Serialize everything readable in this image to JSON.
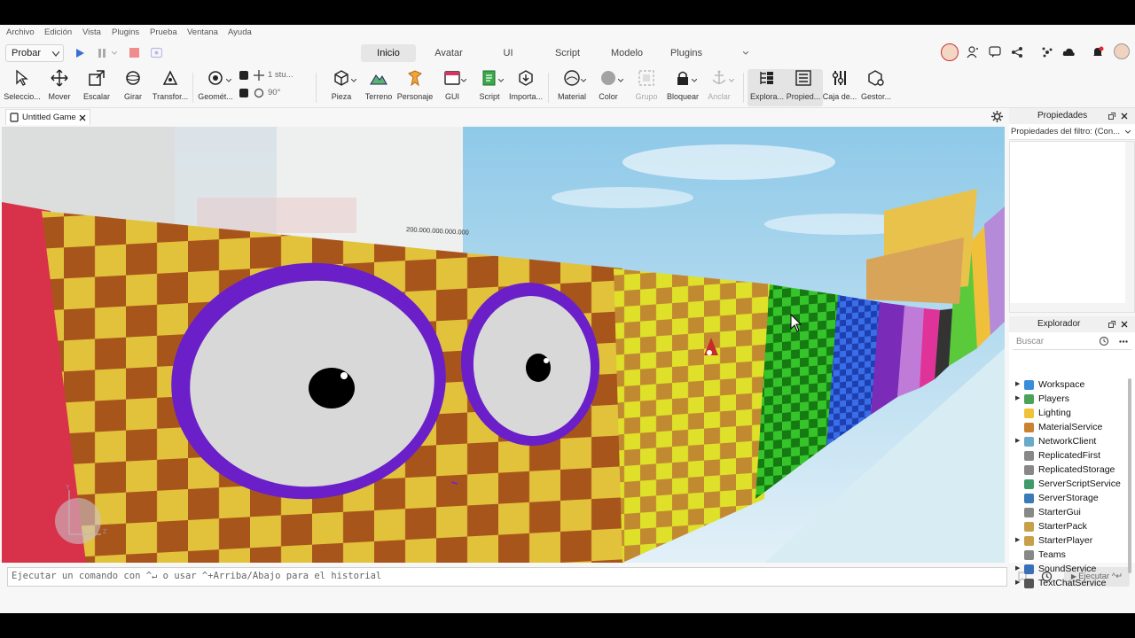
{
  "menu": [
    "Archivo",
    "Edición",
    "Vista",
    "Plugins",
    "Prueba",
    "Ventana",
    "Ayuda"
  ],
  "test_dropdown": "Probar",
  "ribbon_tabs": [
    "Inicio",
    "Avatar",
    "UI",
    "Script",
    "Modelo",
    "Plugins"
  ],
  "tools": {
    "select": "Seleccio...",
    "move": "Mover",
    "scale": "Escalar",
    "rotate": "Girar",
    "transform": "Transfor...",
    "geometry": "Geomét...",
    "move_step": "1 stu...",
    "rotate_step": "90°",
    "part": "Pieza",
    "terrain": "Terreno",
    "character": "Personaje",
    "gui": "GUI",
    "script": "Script",
    "import": "Importa...",
    "material": "Material",
    "color": "Color",
    "group": "Grupo",
    "lock": "Bloquear",
    "anchor": "Anclar",
    "explorer": "Explora...",
    "properties": "Propied...",
    "toolbox": "Caja de...",
    "manager": "Gestor..."
  },
  "doc_tab": "Untitled Game",
  "viewport": {
    "billboard_text": "200.000.000.000.000",
    "axis_y": "Y",
    "axis_z": "Z"
  },
  "properties_panel": {
    "title": "Propiedades",
    "filter": "Propiedades del filtro: (Con..."
  },
  "explorer_panel": {
    "title": "Explorador",
    "search_placeholder": "Buscar",
    "items": [
      {
        "name": "Workspace",
        "expandable": true,
        "color": "#3a8dd8"
      },
      {
        "name": "Players",
        "expandable": true,
        "color": "#4ba35a"
      },
      {
        "name": "Lighting",
        "expandable": false,
        "color": "#f0c23a"
      },
      {
        "name": "MaterialService",
        "expandable": false,
        "color": "#c9822f"
      },
      {
        "name": "NetworkClient",
        "expandable": true,
        "color": "#6aa9c8"
      },
      {
        "name": "ReplicatedFirst",
        "expandable": false,
        "color": "#888888"
      },
      {
        "name": "ReplicatedStorage",
        "expandable": false,
        "color": "#888888"
      },
      {
        "name": "ServerScriptService",
        "expandable": false,
        "color": "#3f9b6a"
      },
      {
        "name": "ServerStorage",
        "expandable": false,
        "color": "#3a7ab8"
      },
      {
        "name": "StarterGui",
        "expandable": false,
        "color": "#888888"
      },
      {
        "name": "StarterPack",
        "expandable": false,
        "color": "#c9a04a"
      },
      {
        "name": "StarterPlayer",
        "expandable": true,
        "color": "#c9a04a"
      },
      {
        "name": "Teams",
        "expandable": false,
        "color": "#888888"
      },
      {
        "name": "SoundService",
        "expandable": true,
        "color": "#3a6fb8"
      },
      {
        "name": "TextChatService",
        "expandable": true,
        "color": "#555555"
      }
    ]
  },
  "command_bar": {
    "placeholder": "Ejecutar un comando con ^↵ o usar ^+Arriba/Abajo para el historial",
    "run_label": "Ejecutar ^↵"
  }
}
